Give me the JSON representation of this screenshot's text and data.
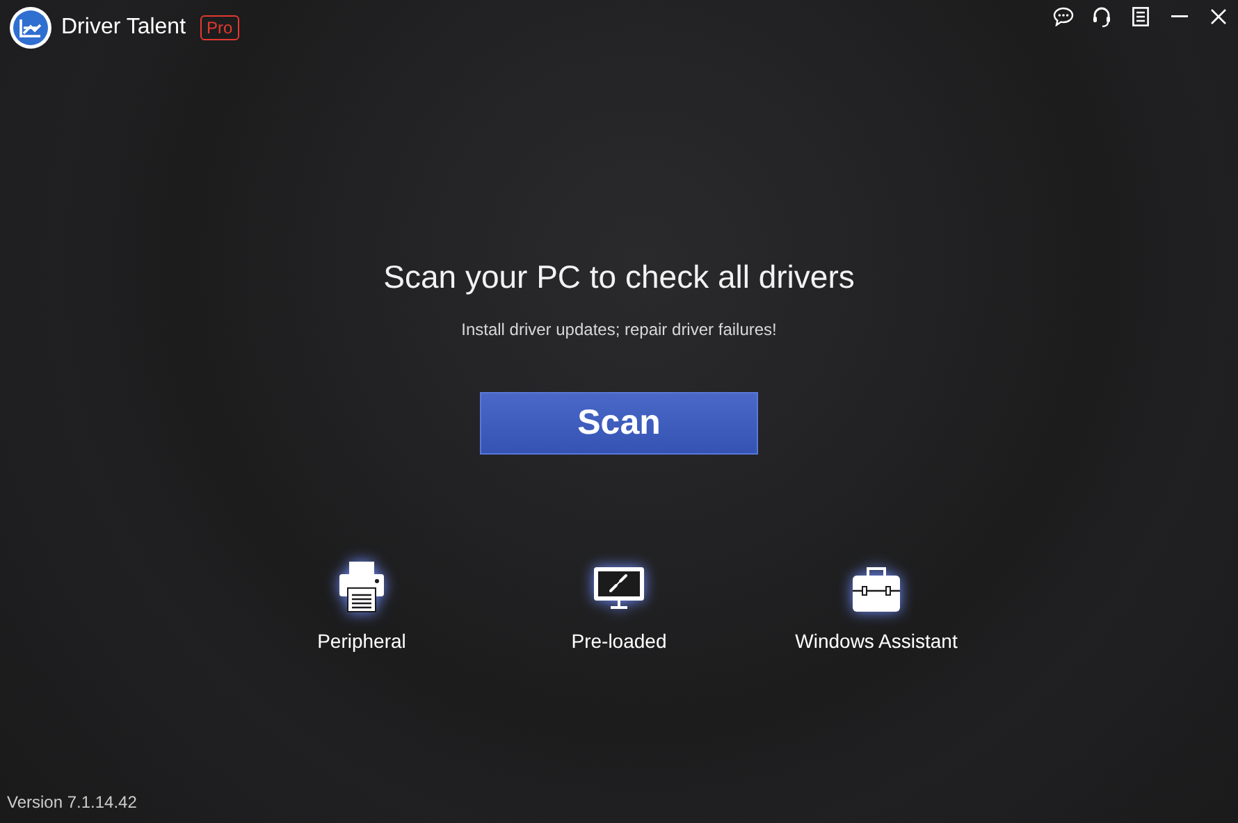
{
  "app": {
    "name": "Driver Talent",
    "badge": "Pro"
  },
  "heading": "Scan your PC to check all drivers",
  "subheading": "Install driver updates; repair driver failures!",
  "scan_button": "Scan",
  "features": [
    {
      "kind": "printer",
      "label": "Peripheral"
    },
    {
      "kind": "monitor",
      "label": "Pre-loaded"
    },
    {
      "kind": "toolbox",
      "label": "Windows Assistant"
    }
  ],
  "version": "Version 7.1.14.42"
}
